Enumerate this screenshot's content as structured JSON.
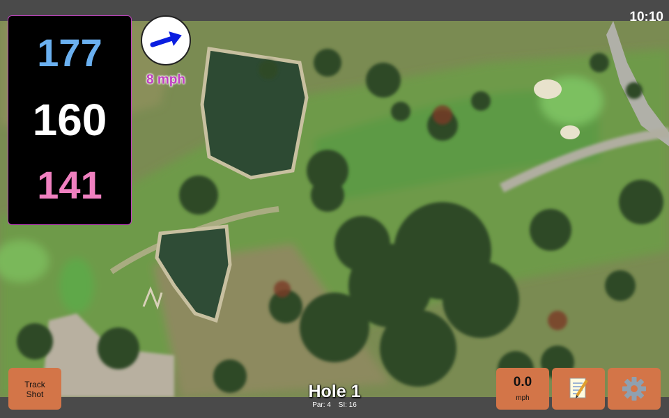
{
  "status_bar": {
    "time": "10:10"
  },
  "yardages": {
    "back": "177",
    "center": "160",
    "front": "141"
  },
  "wind": {
    "speed": "8 mph",
    "icon": "wind-direction-arrow-icon"
  },
  "hole": {
    "title": "Hole 1",
    "par": "Par: 4",
    "stroke_index": "SI: 16"
  },
  "buttons": {
    "track_shot": {
      "line1": "Track",
      "line2": "Shot"
    },
    "speed": {
      "value": "0.0",
      "unit": "mph"
    },
    "notes": {
      "icon": "notepad-icon",
      "glyph": "📝"
    },
    "settings": {
      "icon": "gear-icon",
      "glyph": "⚙"
    }
  },
  "colors": {
    "back_yardage": "#6ab0f0",
    "center_yardage": "#ffffff",
    "front_yardage": "#f080c0",
    "wind_text": "#c040c0",
    "button_bg": "#d37548"
  }
}
